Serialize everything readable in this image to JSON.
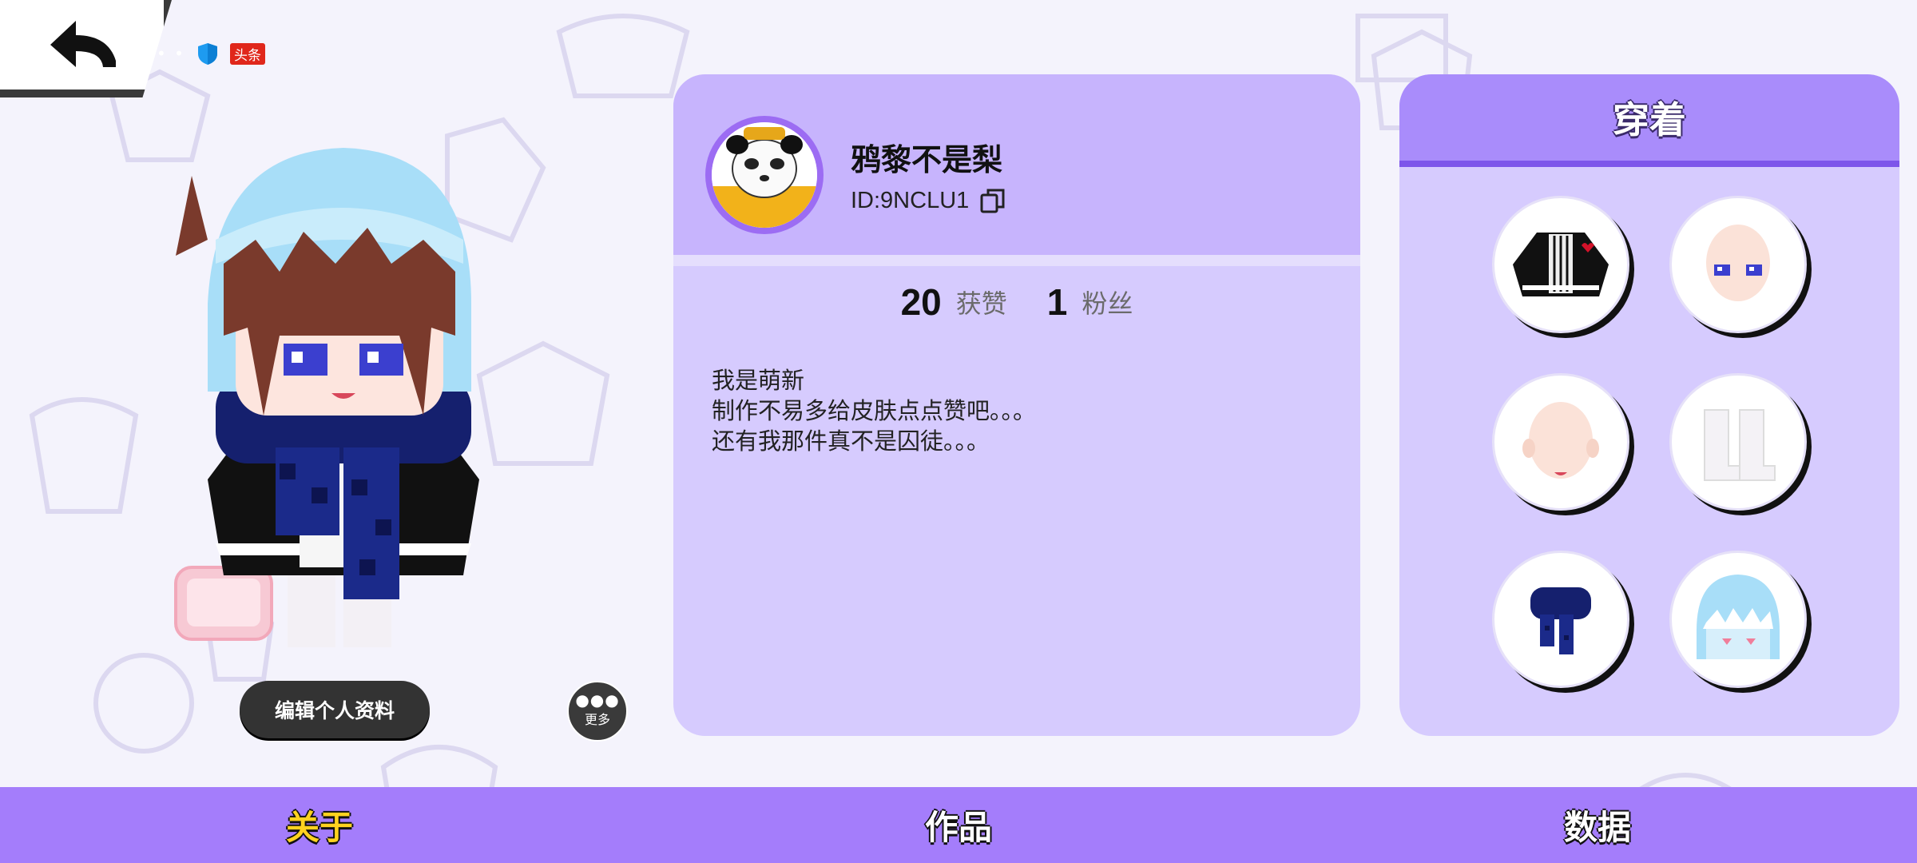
{
  "status_bar": {
    "badge": "头条"
  },
  "profile": {
    "name": "鸦黎不是梨",
    "id": "ID:9NCLU1",
    "stats": [
      {
        "value": "20",
        "label": "获赞"
      },
      {
        "value": "1",
        "label": "粉丝"
      }
    ],
    "bio_lines": [
      "我是萌新",
      "制作不易多给皮肤点点赞吧。。。",
      "还有我那件真不是囚徒。。。"
    ]
  },
  "actions": {
    "edit_profile": "编辑个人资料",
    "more": "更多"
  },
  "wearing": {
    "title": "穿着",
    "items": [
      "jacket-icon",
      "face-icon",
      "head-icon",
      "boots-icon",
      "scarf-icon",
      "shark-hood-icon"
    ]
  },
  "tabs": [
    {
      "label": "关于",
      "active": true
    },
    {
      "label": "作品",
      "active": false
    },
    {
      "label": "数据",
      "active": false
    }
  ],
  "colors": {
    "accent": "#a47dfb",
    "card": "#d6cbfe",
    "active_tab": "#ffd21f"
  }
}
